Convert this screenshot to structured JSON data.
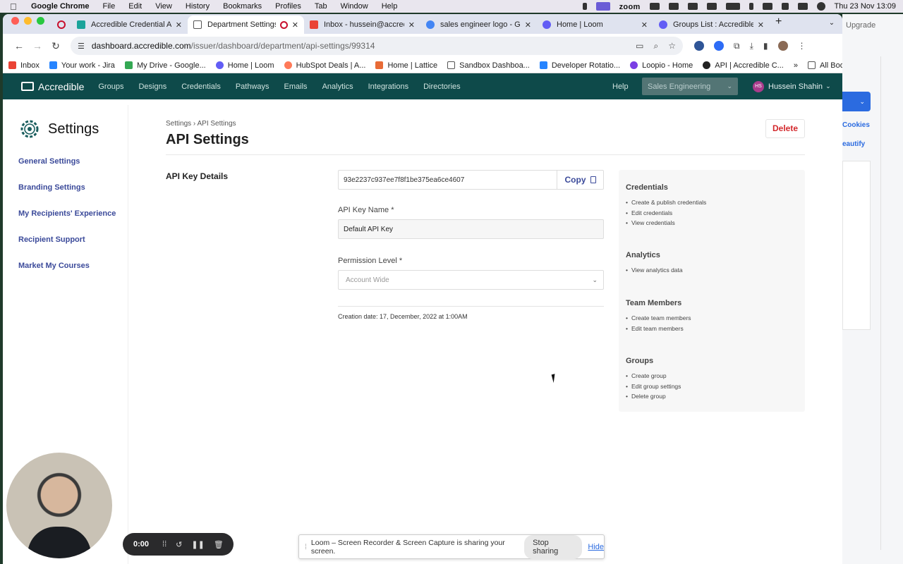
{
  "os_menubar": {
    "app": "Google Chrome",
    "items": [
      "File",
      "Edit",
      "View",
      "History",
      "Bookmarks",
      "Profiles",
      "Tab",
      "Window",
      "Help"
    ],
    "zoom_label": "zoom",
    "datetime": "Thu 23 Nov  13:09"
  },
  "tabs": [
    {
      "label": "Accredible Credential AP",
      "icon": "accredible-icon",
      "color": "#1aa39a"
    },
    {
      "label": "Department Settings",
      "icon": "page-icon",
      "color": "#6b7280",
      "active": true
    },
    {
      "label": "Inbox - hussein@accredib",
      "icon": "gmail-icon",
      "color": "#ea4335"
    },
    {
      "label": "sales engineer logo - Goo",
      "icon": "google-icon",
      "color": "#4285f4"
    },
    {
      "label": "Home | Loom",
      "icon": "loom-icon",
      "color": "#625df5"
    },
    {
      "label": "Groups List : Accredible",
      "icon": "loom-icon",
      "color": "#625df5"
    }
  ],
  "url": {
    "host": "dashboard.accredible.com",
    "path": "/issuer/dashboard/department/api-settings/99314"
  },
  "bookmarks": [
    {
      "label": "Inbox",
      "color": "#ea4335"
    },
    {
      "label": "Your work - Jira",
      "color": "#2684ff"
    },
    {
      "label": "My Drive - Google...",
      "color": "#34a853"
    },
    {
      "label": "Home | Loom",
      "color": "#625df5"
    },
    {
      "label": "HubSpot Deals | A...",
      "color": "#ff7a59"
    },
    {
      "label": "Home | Lattice",
      "color": "#e86b36"
    },
    {
      "label": "Sandbox Dashboa...",
      "color": "#555555"
    },
    {
      "label": "Developer Rotatio...",
      "color": "#2684ff"
    },
    {
      "label": "Loopio - Home",
      "color": "#7b3fe4"
    },
    {
      "label": "API | Accredible C...",
      "color": "#222222"
    }
  ],
  "all_bookmarks": "All Bookmarks",
  "app_nav": {
    "brand": "Accredible",
    "links": [
      "Groups",
      "Designs",
      "Credentials",
      "Pathways",
      "Emails",
      "Analytics",
      "Integrations",
      "Directories"
    ],
    "help": "Help",
    "department": "Sales Engineering",
    "user_initials": "HS",
    "user_name": "Hussein Shahin"
  },
  "sidebar": {
    "title": "Settings",
    "items": [
      "General Settings",
      "Branding Settings",
      "My Recipients' Experience",
      "Recipient Support",
      "Market My Courses"
    ]
  },
  "breadcrumb": {
    "root": "Settings",
    "current": "API Settings"
  },
  "page_title": "API Settings",
  "delete_label": "Delete",
  "api_key_section": "API Key Details",
  "api_key_value": "93e2237c937ee7f8f1be375ea6ce4607",
  "copy_label": "Copy",
  "key_name_label": "API Key Name *",
  "key_name_value": "Default API Key",
  "permission_label": "Permission Level *",
  "permission_value": "Account Wide",
  "creation_date": "Creation date: 17, December, 2022 at 1:00AM",
  "permissions": [
    {
      "heading": "Credentials",
      "items": [
        "Create & publish credentials",
        "Edit credentials",
        "View credentials"
      ]
    },
    {
      "heading": "Analytics",
      "items": [
        "View analytics data"
      ]
    },
    {
      "heading": "Team Members",
      "items": [
        "Create team members",
        "Edit team members"
      ]
    },
    {
      "heading": "Groups",
      "items": [
        "Create group",
        "Edit group settings",
        "Delete group"
      ]
    }
  ],
  "behind_window": {
    "upgrade": "Upgrade",
    "link1": "Cookies",
    "link2": "eautify"
  },
  "recorder": {
    "time": "0:00"
  },
  "share_bar": {
    "message": "Loom – Screen Recorder & Screen Capture is sharing your screen.",
    "stop": "Stop sharing",
    "hide": "Hide"
  }
}
